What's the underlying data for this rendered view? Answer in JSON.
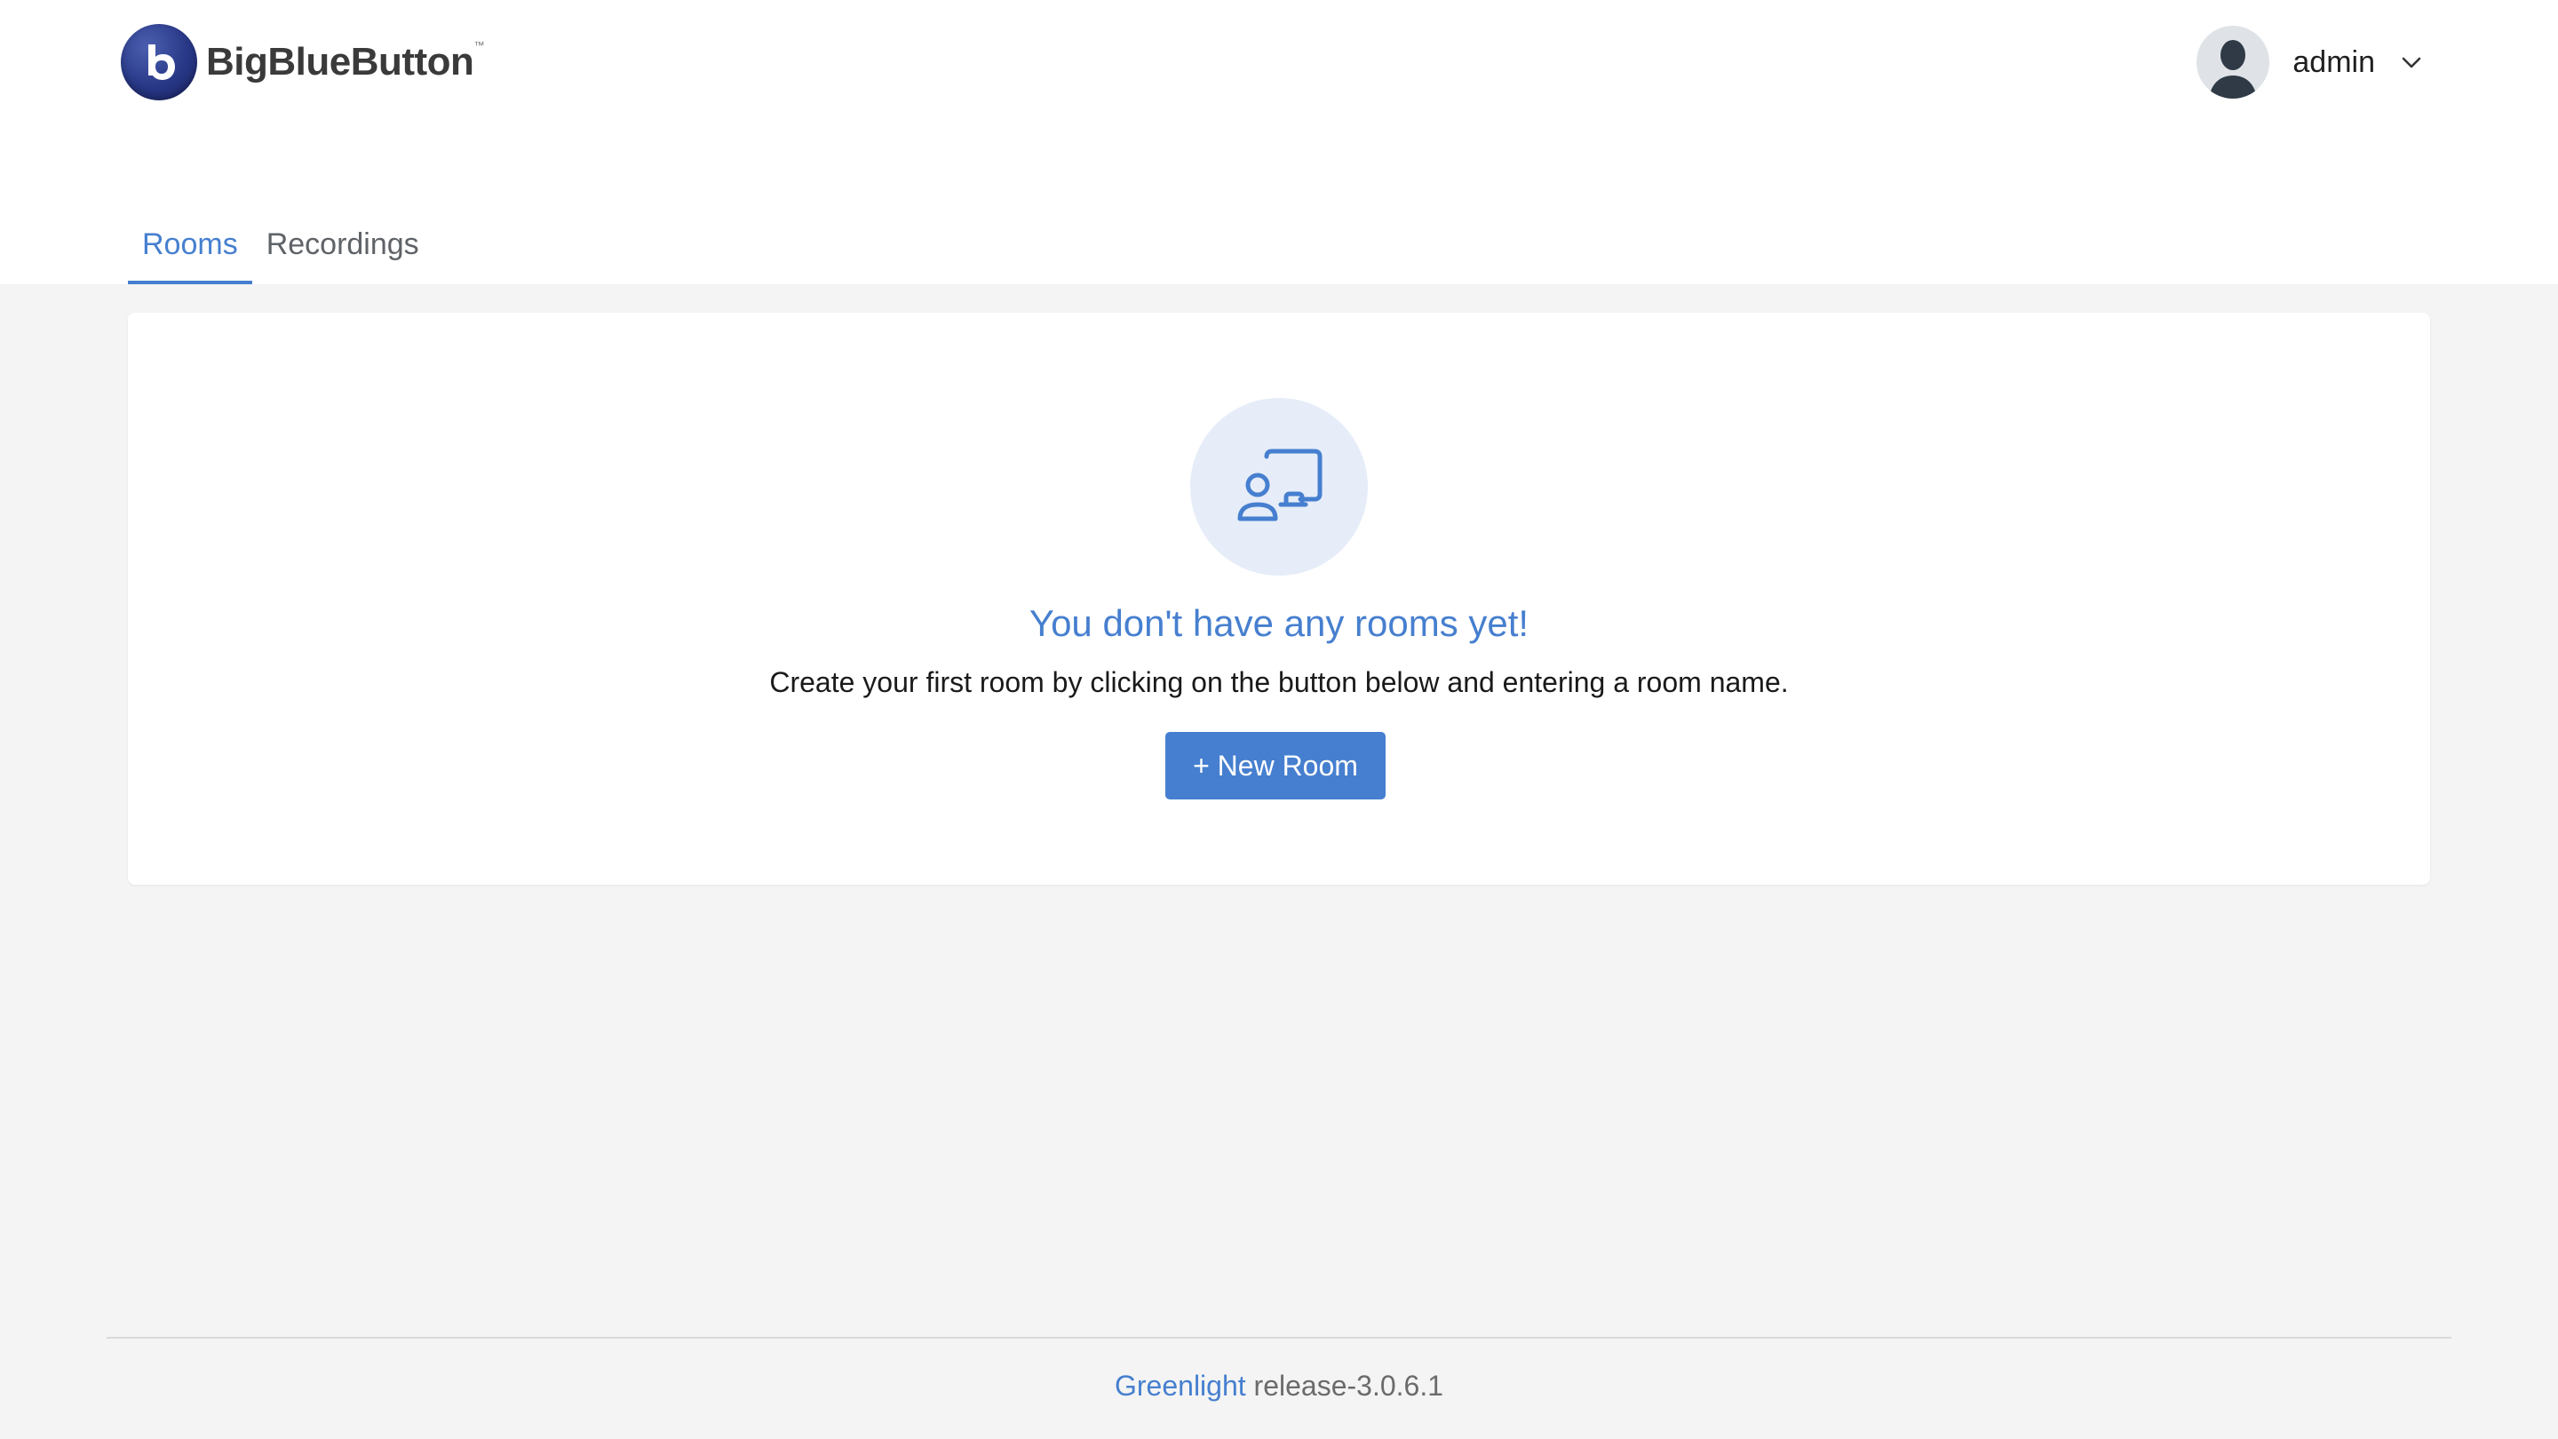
{
  "header": {
    "brand_name": "BigBlueButton",
    "brand_tm": "™",
    "user_name": "admin"
  },
  "tabs": [
    {
      "label": "Rooms",
      "active": true
    },
    {
      "label": "Recordings",
      "active": false
    }
  ],
  "empty_state": {
    "title": "You don't have any rooms yet!",
    "description": "Create your first room by clicking on the button below and entering a room name.",
    "button_label": "+ New Room"
  },
  "footer": {
    "link_text": "Greenlight",
    "version": "release-3.0.6.1"
  },
  "colors": {
    "accent": "#467fcf",
    "background": "#f4f4f4",
    "icon_bg": "#e6edf8"
  },
  "icons": {
    "brand": "bigbluebutton-logo-icon",
    "avatar": "user-avatar-icon",
    "dropdown": "chevron-down-icon",
    "empty_state": "presenter-screen-icon"
  }
}
